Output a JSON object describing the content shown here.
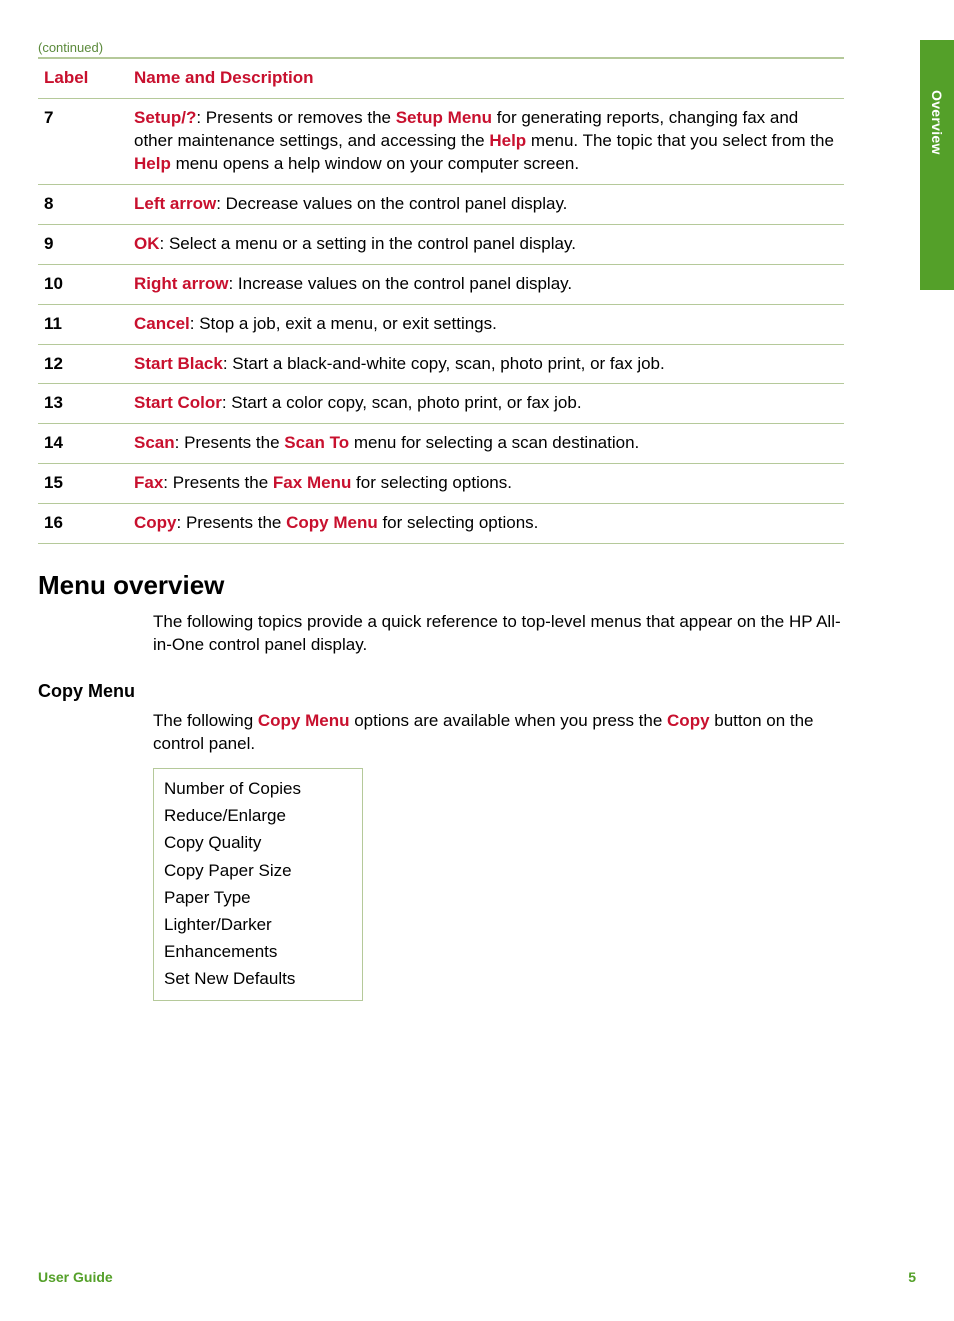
{
  "sideTab": "Overview",
  "continued": "(continued)",
  "table": {
    "headers": {
      "label": "Label",
      "desc": "Name and Description"
    },
    "rows": [
      {
        "label": "7",
        "parts": [
          {
            "t": "term",
            "v": "Setup/?"
          },
          {
            "t": "text",
            "v": ": Presents or removes the "
          },
          {
            "t": "term",
            "v": "Setup Menu"
          },
          {
            "t": "text",
            "v": " for generating reports, changing fax and other maintenance settings, and accessing the "
          },
          {
            "t": "term",
            "v": "Help"
          },
          {
            "t": "text",
            "v": " menu. The topic that you select from the "
          },
          {
            "t": "term",
            "v": "Help"
          },
          {
            "t": "text",
            "v": " menu opens a help window on your computer screen."
          }
        ]
      },
      {
        "label": "8",
        "parts": [
          {
            "t": "term",
            "v": "Left arrow"
          },
          {
            "t": "text",
            "v": ": Decrease values on the control panel display."
          }
        ]
      },
      {
        "label": "9",
        "parts": [
          {
            "t": "term",
            "v": "OK"
          },
          {
            "t": "text",
            "v": ": Select a menu or a setting in the control panel display."
          }
        ]
      },
      {
        "label": "10",
        "parts": [
          {
            "t": "term",
            "v": "Right arrow"
          },
          {
            "t": "text",
            "v": ": Increase values on the control panel display."
          }
        ]
      },
      {
        "label": "11",
        "parts": [
          {
            "t": "term",
            "v": "Cancel"
          },
          {
            "t": "text",
            "v": ": Stop a job, exit a menu, or exit settings."
          }
        ]
      },
      {
        "label": "12",
        "parts": [
          {
            "t": "term",
            "v": "Start Black"
          },
          {
            "t": "text",
            "v": ": Start a black-and-white copy, scan, photo print, or fax job."
          }
        ]
      },
      {
        "label": "13",
        "parts": [
          {
            "t": "term",
            "v": "Start Color"
          },
          {
            "t": "text",
            "v": ": Start a color copy, scan, photo print, or fax job."
          }
        ]
      },
      {
        "label": "14",
        "parts": [
          {
            "t": "term",
            "v": "Scan"
          },
          {
            "t": "text",
            "v": ": Presents the "
          },
          {
            "t": "term",
            "v": "Scan To"
          },
          {
            "t": "text",
            "v": " menu for selecting a scan destination."
          }
        ]
      },
      {
        "label": "15",
        "parts": [
          {
            "t": "term",
            "v": "Fax"
          },
          {
            "t": "text",
            "v": ": Presents the "
          },
          {
            "t": "term",
            "v": "Fax Menu"
          },
          {
            "t": "text",
            "v": " for selecting options."
          }
        ]
      },
      {
        "label": "16",
        "parts": [
          {
            "t": "term",
            "v": "Copy"
          },
          {
            "t": "text",
            "v": ": Presents the "
          },
          {
            "t": "term",
            "v": "Copy Menu"
          },
          {
            "t": "text",
            "v": " for selecting options."
          }
        ]
      }
    ]
  },
  "section": {
    "title": "Menu overview",
    "intro": "The following topics provide a quick reference to top-level menus that appear on the HP All-in-One control panel display."
  },
  "subsection": {
    "title": "Copy Menu",
    "intro_parts": [
      {
        "t": "text",
        "v": "The following "
      },
      {
        "t": "term",
        "v": "Copy Menu"
      },
      {
        "t": "text",
        "v": " options are available when you press the "
      },
      {
        "t": "term",
        "v": "Copy"
      },
      {
        "t": "text",
        "v": " button on the control panel."
      }
    ],
    "items": [
      "Number of Copies",
      "Reduce/Enlarge",
      "Copy Quality",
      "Copy Paper Size",
      "Paper Type",
      "Lighter/Darker",
      "Enhancements",
      "Set New Defaults"
    ]
  },
  "footer": {
    "guide": "User Guide",
    "page": "5"
  }
}
